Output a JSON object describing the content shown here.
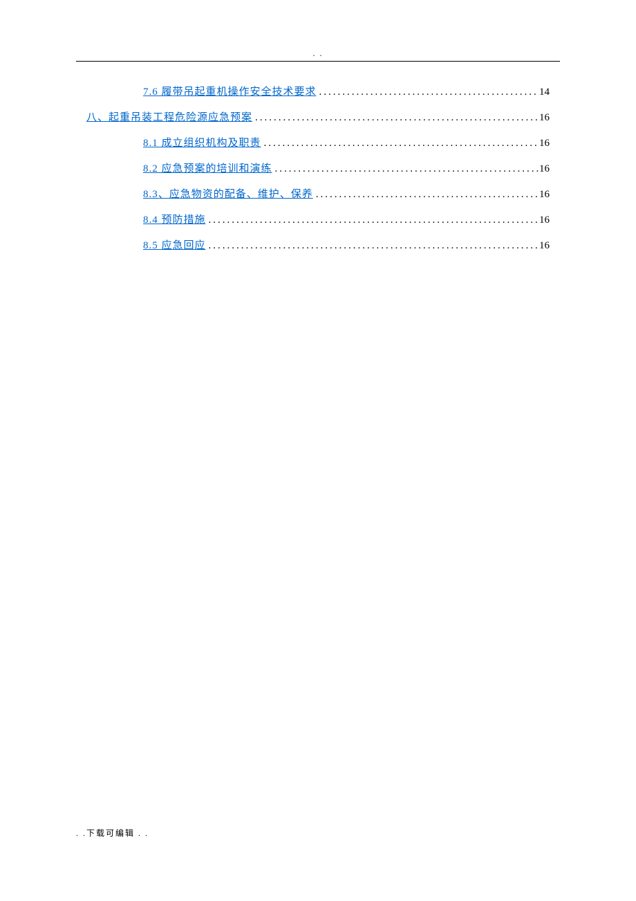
{
  "header_mark": ". .",
  "footer_mark": ". .下载可编辑   . .",
  "toc": [
    {
      "level": 2,
      "label": "7.6 履带吊起重机操作安全技术要求",
      "page": "14"
    },
    {
      "level": 1,
      "label": "八、起重吊装工程危险源应急预案",
      "page": "16"
    },
    {
      "level": 2,
      "label": "8.1 成立组织机构及职责",
      "page": "16"
    },
    {
      "level": 2,
      "label": "8.2 应急预案的培训和演练",
      "page": "16"
    },
    {
      "level": 2,
      "label": "8.3、应急物资的配备、维护、保养",
      "page": "16"
    },
    {
      "level": 2,
      "label": "8.4 预防措施",
      "page": "16"
    },
    {
      "level": 2,
      "label": "8.5 应急回应",
      "page": "16"
    }
  ]
}
